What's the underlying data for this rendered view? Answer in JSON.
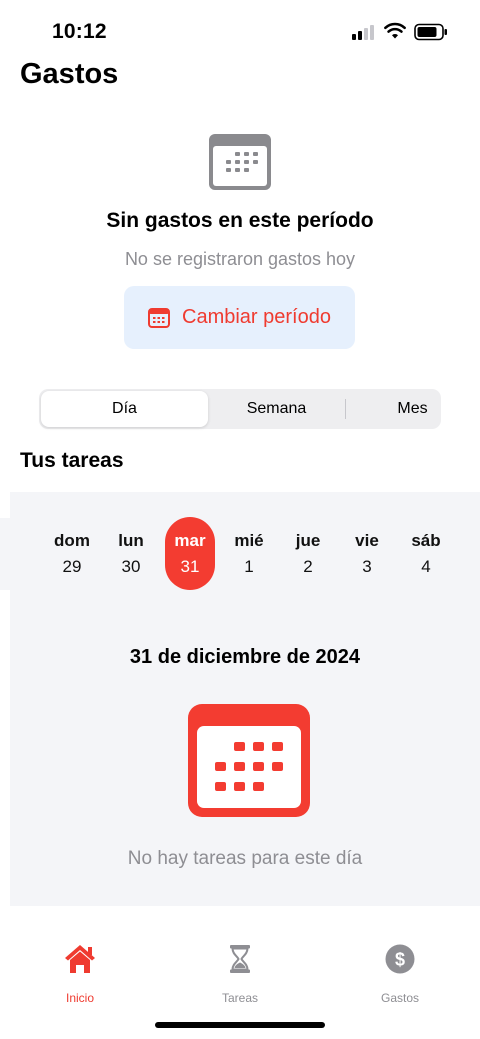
{
  "status_bar": {
    "time": "10:12"
  },
  "header": {
    "title": "Gastos"
  },
  "empty_state": {
    "icon": "calendar-icon",
    "title": "Sin gastos en este período",
    "subtitle": "No se registraron gastos hoy",
    "button_label": "Cambiar período",
    "button_icon": "calendar-icon"
  },
  "segmented": {
    "options": [
      "Día",
      "Semana",
      "Mes"
    ],
    "selected": "Día"
  },
  "tasks": {
    "section_title": "Tus tareas",
    "days": [
      {
        "name": "dom",
        "date": "29"
      },
      {
        "name": "lun",
        "date": "30"
      },
      {
        "name": "mar",
        "date": "31"
      },
      {
        "name": "mié",
        "date": "1"
      },
      {
        "name": "jue",
        "date": "2"
      },
      {
        "name": "vie",
        "date": "3"
      },
      {
        "name": "sáb",
        "date": "4"
      }
    ],
    "selected_day": "mar",
    "date_heading": "31 de diciembre de 2024",
    "empty_icon": "calendar-icon",
    "empty_text": "No hay tareas para este día"
  },
  "tab_bar": {
    "items": [
      {
        "label": "Inicio",
        "icon": "house-icon",
        "active": true
      },
      {
        "label": "Tareas",
        "icon": "hourglass-icon",
        "active": false
      },
      {
        "label": "Gastos",
        "icon": "dollar-circle-icon",
        "active": false
      }
    ]
  },
  "colors": {
    "accent": "#ef3b30",
    "button_bg": "#e6f0fd",
    "panel_bg": "#f4f5f8",
    "secondary_text": "#8e8e93"
  }
}
